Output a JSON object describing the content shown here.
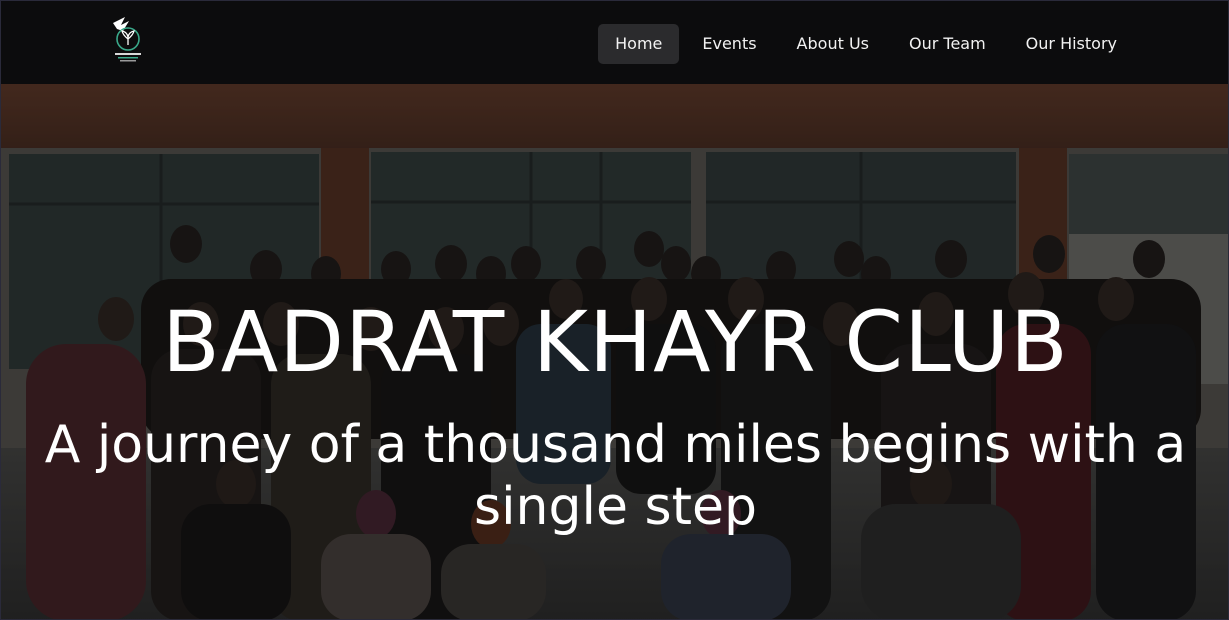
{
  "nav": {
    "items": [
      {
        "label": "Home",
        "active": true
      },
      {
        "label": "Events",
        "active": false
      },
      {
        "label": "About Us",
        "active": false
      },
      {
        "label": "Our Team",
        "active": false
      },
      {
        "label": "Our History",
        "active": false
      }
    ]
  },
  "hero": {
    "title": "BADRAT KHAYR CLUB",
    "subtitle": "A journey of a thousand miles begins with a single step"
  },
  "colors": {
    "navbar_bg": "#0c0c0d",
    "active_tab_bg": "#2b2b2d",
    "logo_accent": "#3aa98a",
    "text": "#ffffff"
  }
}
